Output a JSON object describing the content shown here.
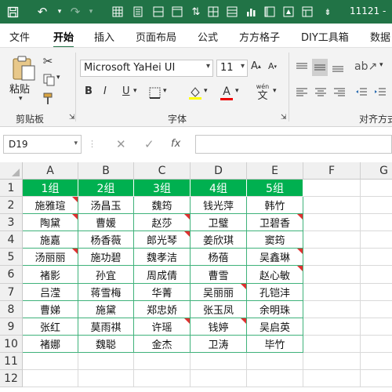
{
  "window": {
    "title": "11121 -"
  },
  "tabs": [
    "文件",
    "开始",
    "插入",
    "页面布局",
    "公式",
    "方方格子",
    "DIY工具箱",
    "数据"
  ],
  "active_tab": "开始",
  "ribbon": {
    "clipboard": {
      "paste_label": "粘贴",
      "group_label": "剪贴板"
    },
    "font": {
      "name": "Microsoft YaHei UI",
      "size": "11",
      "bold": "B",
      "italic": "I",
      "underline": "U",
      "group_label": "字体",
      "phonetic": "wén"
    },
    "alignment": {
      "group_label": "对齐方式"
    }
  },
  "formula_bar": {
    "name_box": "D19",
    "fx": "fx",
    "formula": ""
  },
  "columns": [
    "A",
    "B",
    "C",
    "D",
    "E",
    "F",
    "G"
  ],
  "rows": [
    "1",
    "2",
    "3",
    "4",
    "5",
    "6",
    "7",
    "8",
    "9",
    "10",
    "11",
    "12"
  ],
  "table": {
    "headers": [
      "1组",
      "2组",
      "3组",
      "4组",
      "5组"
    ],
    "rows": [
      [
        "施雅瑄",
        "汤昌玉",
        "魏筠",
        "钱光萍",
        "韩竹"
      ],
      [
        "陶黛",
        "曹媛",
        "赵莎",
        "卫璧",
        "卫碧香"
      ],
      [
        "施嘉",
        "杨香薇",
        "郎光琴",
        "姜欣琪",
        "窦筠"
      ],
      [
        "汤丽丽",
        "施功碧",
        "魏孝洁",
        "杨蓓",
        "吴鑫琳"
      ],
      [
        "褚影",
        "孙宜",
        "周成倩",
        "曹雪",
        "赵心敏"
      ],
      [
        "吕滢",
        "蒋雪梅",
        "华菁",
        "吴丽丽",
        "孔铠沣"
      ],
      [
        "曹娣",
        "施黛",
        "郑忠娇",
        "张玉凤",
        "余明珠"
      ],
      [
        "张红",
        "莫雨祺",
        "许瑶",
        "钱婷",
        "吴启英"
      ],
      [
        "褚娜",
        "魏聪",
        "金杰",
        "卫涛",
        "毕竹"
      ]
    ]
  },
  "colors": {
    "accent": "#217346",
    "header_fill": "#00b050",
    "comment_flag": "#e03131"
  }
}
